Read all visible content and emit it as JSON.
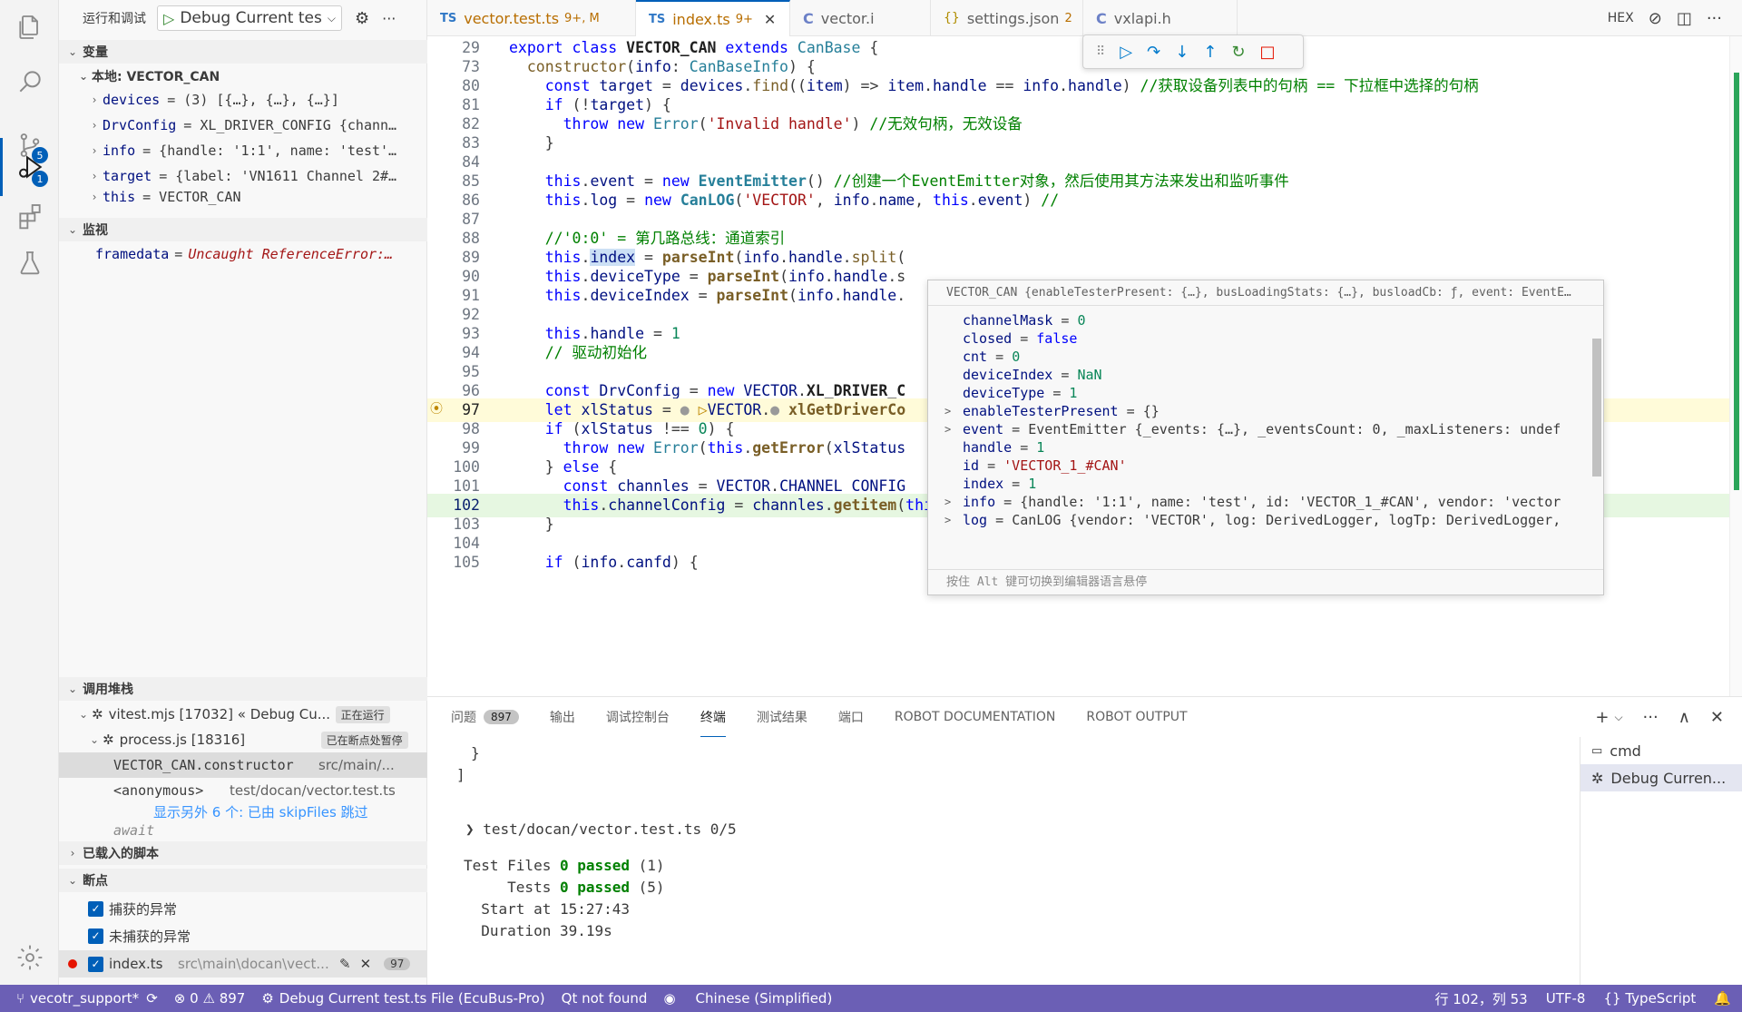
{
  "sidebar": {
    "title": "运行和调试",
    "config": "Debug Current tes",
    "variables_header": "变量",
    "local_header": "本地: VECTOR_CAN",
    "variables": [
      {
        "name": "devices",
        "value": "= (3) [{…}, {…}, {…}]"
      },
      {
        "name": "DrvConfig",
        "value": "= XL_DRIVER_CONFIG {chann…"
      },
      {
        "name": "info",
        "value": "= {handle: '1:1', name: 'test'…"
      },
      {
        "name": "target",
        "value": "= {label: 'VN1611 Channel 2#…"
      },
      {
        "name": "this",
        "value": "= VECTOR_CAN"
      }
    ],
    "watch_header": "监视",
    "watch": {
      "name": "framedata",
      "value": "Uncaught ReferenceError:…"
    },
    "callstack_header": "调用堆栈",
    "callstack": [
      {
        "name": "vitest.mjs [17032] « Debug Cu...",
        "tag": "正在运行"
      },
      {
        "name": "process.js [18316]",
        "tag": "已在断点处暂停"
      },
      {
        "name": "VECTOR_CAN.constructor",
        "file": "src/main/..."
      },
      {
        "name": "<anonymous>",
        "file": "test/docan/vector.test.ts"
      }
    ],
    "skip_text": "显示另外 6 个: 已由 skipFiles 跳过",
    "await": "await",
    "loaded_scripts": "已载入的脚本",
    "breakpoints_header": "断点",
    "breakpoints": [
      {
        "label": "捕获的异常"
      },
      {
        "label": "未捕获的异常"
      },
      {
        "label": "index.ts",
        "path": "src\\main\\docan\\vect...",
        "count": "97"
      }
    ]
  },
  "activity": {
    "scm_badge": "5",
    "debug_badge": "1"
  },
  "tabs": [
    {
      "icon": "TS",
      "label": "vector.test.ts",
      "status": "9+, M"
    },
    {
      "icon": "TS",
      "label": "index.ts",
      "status": "9+"
    },
    {
      "icon": "C",
      "label": "vector.i",
      "status": ""
    },
    {
      "icon": "{}",
      "label": "settings.json",
      "status": "2"
    },
    {
      "icon": "C",
      "label": "vxlapi.h",
      "status": ""
    }
  ],
  "tab_right": {
    "hex": "HEX"
  },
  "hover": {
    "header": "VECTOR_CAN {enableTesterPresent: {…}, busLoadingStats: {…}, busloadCb: ƒ, event: EventE…",
    "rows": [
      {
        "key": "channelMask",
        "val": "0",
        "type": "num",
        "chev": ""
      },
      {
        "key": "closed",
        "val": "false",
        "type": "kw",
        "chev": ""
      },
      {
        "key": "cnt",
        "val": "0",
        "type": "num",
        "chev": ""
      },
      {
        "key": "deviceIndex",
        "val": "NaN",
        "type": "num",
        "chev": ""
      },
      {
        "key": "deviceType",
        "val": "1",
        "type": "num",
        "chev": ""
      },
      {
        "key": "enableTesterPresent",
        "val": "{}",
        "type": "plain",
        "chev": ">"
      },
      {
        "key": "event",
        "val": "EventEmitter {_events: {…}, _eventsCount: 0, _maxListeners: undef",
        "type": "plain",
        "chev": ">"
      },
      {
        "key": "handle",
        "val": "1",
        "type": "num",
        "chev": ""
      },
      {
        "key": "id",
        "val": "'VECTOR_1_#CAN'",
        "type": "str",
        "chev": ""
      },
      {
        "key": "index",
        "val": "1",
        "type": "num",
        "chev": ""
      },
      {
        "key": "info",
        "val": "{handle: '1:1', name: 'test', id: 'VECTOR_1_#CAN', vendor: 'vector",
        "type": "plain",
        "chev": ">"
      },
      {
        "key": "log",
        "val": "CanLOG {vendor: 'VECTOR', log: DerivedLogger, logTp: DerivedLogger,",
        "type": "plain",
        "chev": ">"
      }
    ],
    "footer": "按住 Alt 键可切换到编辑器语言悬停"
  },
  "panel": {
    "tabs": [
      {
        "label": "问题",
        "badge": "897"
      },
      {
        "label": "输出"
      },
      {
        "label": "调试控制台"
      },
      {
        "label": "终端"
      },
      {
        "label": "测试结果"
      },
      {
        "label": "端口"
      },
      {
        "label": "ROBOT DOCUMENTATION"
      },
      {
        "label": "ROBOT OUTPUT"
      }
    ],
    "terminal": {
      "l1": "}",
      "l2": "]",
      "l3": "❯ test/docan/vector.test.ts 0/5",
      "l4a": "Test Files ",
      "l4b": "0 passed",
      "l4c": " (1)",
      "l5a": "     Tests ",
      "l5b": "0 passed",
      "l5c": " (5)",
      "l6": "  Start at 15:27:43",
      "l7": "  Duration 39.19s"
    },
    "terminals": [
      {
        "label": "cmd"
      },
      {
        "label": "Debug Curren..."
      }
    ]
  },
  "status": {
    "branch": "vecotr_support*",
    "errors": "0",
    "warnings": "897",
    "debug": "Debug Current test.ts File (EcuBus-Pro)",
    "qt": "Qt not found",
    "lang_ui": "Chinese (Simplified)",
    "position": "行 102，列 53",
    "encoding": "UTF-8",
    "language": "TypeScript"
  }
}
